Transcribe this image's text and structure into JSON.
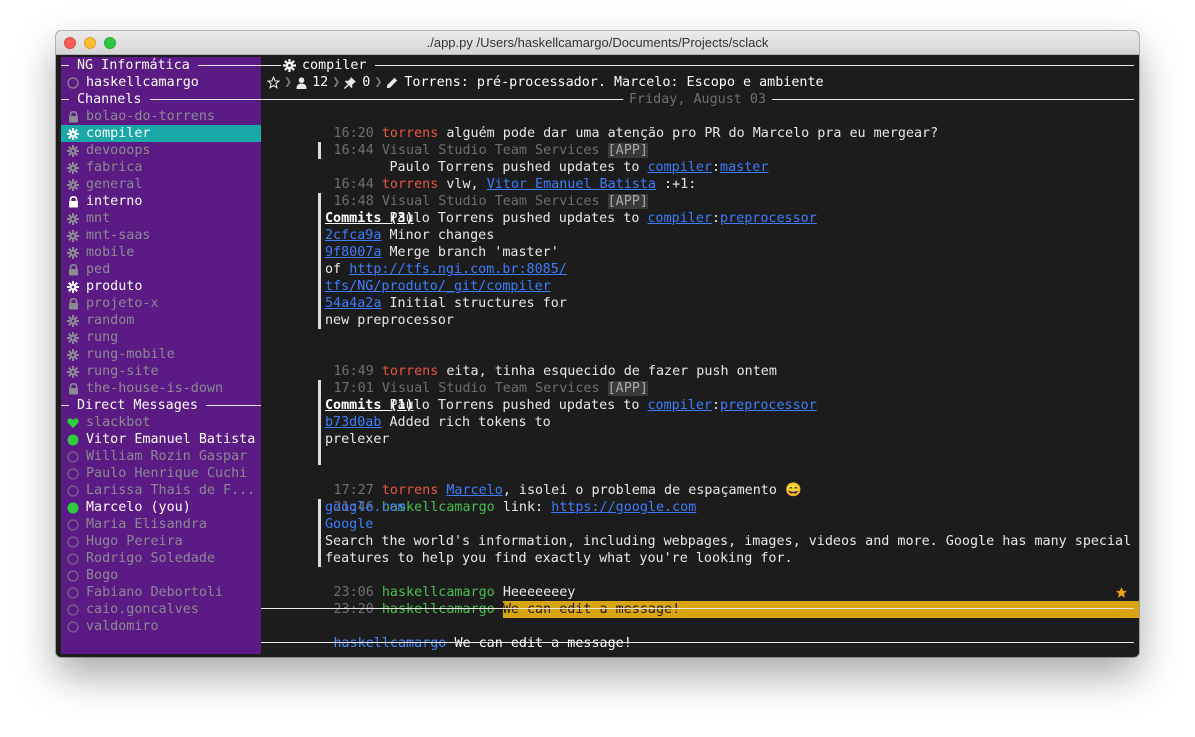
{
  "window": {
    "title": "./app.py  /Users/haskellcamargo/Documents/Projects/sclack"
  },
  "sidebar": {
    "team_name": "NG Informática",
    "username": "haskellcamargo",
    "channels_header": "Channels",
    "channels": [
      {
        "name": "bolao-do-torrens",
        "icon": "lock",
        "state": "muted"
      },
      {
        "name": "compiler",
        "icon": "gear",
        "state": "selected"
      },
      {
        "name": "devooops",
        "icon": "gear",
        "state": "muted"
      },
      {
        "name": "fabrica",
        "icon": "gear",
        "state": "muted"
      },
      {
        "name": "general",
        "icon": "gear",
        "state": "muted"
      },
      {
        "name": "interno",
        "icon": "lock",
        "state": "unread"
      },
      {
        "name": "mnt",
        "icon": "gear",
        "state": "muted"
      },
      {
        "name": "mnt-saas",
        "icon": "gear",
        "state": "muted"
      },
      {
        "name": "mobile",
        "icon": "gear",
        "state": "muted"
      },
      {
        "name": "ped",
        "icon": "lock",
        "state": "muted"
      },
      {
        "name": "produto",
        "icon": "gear",
        "state": "unread"
      },
      {
        "name": "projeto-x",
        "icon": "lock",
        "state": "muted"
      },
      {
        "name": "random",
        "icon": "gear",
        "state": "muted"
      },
      {
        "name": "rung",
        "icon": "gear",
        "state": "muted"
      },
      {
        "name": "rung-mobile",
        "icon": "gear",
        "state": "muted"
      },
      {
        "name": "rung-site",
        "icon": "gear",
        "state": "muted"
      },
      {
        "name": "the-house-is-down",
        "icon": "lock",
        "state": "muted"
      }
    ],
    "dm_header": "Direct Messages",
    "direct_messages": [
      {
        "name": "slackbot",
        "presence": "heart",
        "state": "muted"
      },
      {
        "name": "Vitor Emanuel Batista",
        "presence": "online",
        "state": "unread"
      },
      {
        "name": "William Rozin Gaspar",
        "presence": "away",
        "state": "muted"
      },
      {
        "name": "Paulo Henrique Cuchi",
        "presence": "away",
        "state": "muted"
      },
      {
        "name": "Larissa Thais de F...",
        "presence": "away",
        "state": "muted"
      },
      {
        "name": "Marcelo (you)",
        "presence": "online",
        "state": "unread"
      },
      {
        "name": "Maria Elisandra",
        "presence": "away",
        "state": "muted"
      },
      {
        "name": "Hugo Pereira",
        "presence": "away",
        "state": "muted"
      },
      {
        "name": "Rodrigo Soledade",
        "presence": "away",
        "state": "muted"
      },
      {
        "name": "Bogo",
        "presence": "away",
        "state": "muted"
      },
      {
        "name": "Fabiano Debortoli",
        "presence": "away",
        "state": "muted"
      },
      {
        "name": "caio.goncalves",
        "presence": "away",
        "state": "muted"
      },
      {
        "name": "valdomiro",
        "presence": "away",
        "state": "muted"
      }
    ]
  },
  "channel_header": {
    "name": "compiler",
    "member_count": "12",
    "pin_count": "0",
    "topic": "Torrens: pré-processador. Marcelo: Escopo e ambiente"
  },
  "date_divider": "Friday, August 03",
  "messages": {
    "m1": {
      "time": "16:20",
      "user": "torrens",
      "text": "alguém pode dar uma atenção pro PR do Marcelo pra eu mergear?"
    },
    "m2": {
      "time": "16:44",
      "user": "Visual Studio Team Services",
      "tag": "[APP]",
      "push": {
        "prefix": "Paulo Torrens pushed updates to ",
        "repo": "compiler",
        "sep": ":",
        "branch": "master"
      }
    },
    "m3": {
      "time": "16:44",
      "user": "torrens",
      "pre": "vlw, ",
      "mention": "Vitor Emanuel Batista",
      "post": " :+1:"
    },
    "m4": {
      "time": "16:48",
      "user": "Visual Studio Team Services",
      "tag": "[APP]",
      "push": {
        "prefix": "Paulo Torrens pushed updates to ",
        "repo": "compiler",
        "sep": ":",
        "branch": "preprocessor"
      },
      "commits_title": "Commits (3)",
      "c1_hash": "2cfca9a",
      "c1_msg": " Minor changes",
      "c2_hash": "9f8007a",
      "c2_msg": " Merge branch 'master'",
      "c2_of": "of ",
      "c2_url1": "http://tfs.ngi.com.br:8085/",
      "c2_url2": "tfs/NG/produto/_git/compiler",
      "c3_hash": "54a4a2a",
      "c3_msg": " Initial structures for",
      "c3_msg2": "new preprocessor"
    },
    "m5": {
      "time": "16:49",
      "user": "torrens",
      "text": "eita, tinha esquecido de fazer push ontem"
    },
    "m6": {
      "time": "17:01",
      "user": "Visual Studio Team Services",
      "tag": "[APP]",
      "push": {
        "prefix": "Paulo Torrens pushed updates to ",
        "repo": "compiler",
        "sep": ":",
        "branch": "preprocessor"
      },
      "commits_title": "Commits (1)",
      "c1_hash": "b73d0ab",
      "c1_msg": " Added rich tokens to",
      "c1_msg2": "prelexer"
    },
    "m7": {
      "time": "17:27",
      "user": "torrens",
      "mention": "Marcelo",
      "post": ", isolei o problema de espaçamento",
      "emoji": "😄"
    },
    "m8": {
      "time": "21:46",
      "user": "haskellcamargo",
      "pre": "link: ",
      "url": "https://google.com",
      "preview": {
        "site": "google.com",
        "title": "Google",
        "desc1": "Search the world's information, including webpages, images, videos and more. Google has many special",
        "desc2": "features to help you find exactly what you're looking for."
      }
    },
    "m9": {
      "time": "23:06",
      "user": "haskellcamargo",
      "text": "Heeeeeeey"
    },
    "m10": {
      "time": "23:20",
      "user": "haskellcamargo",
      "text": "We can edit a message!"
    }
  },
  "composer": {
    "user": "haskellcamargo",
    "text": "We can edit a message!"
  },
  "colors": {
    "sidebar_bg": "#5b1a84",
    "selected_bg": "#19a8a8",
    "highlight_bg": "#d9a50e",
    "link": "#3d7dff",
    "user_red": "#e8563f",
    "user_green": "#46c14a",
    "presence_online": "#2ecc40"
  }
}
